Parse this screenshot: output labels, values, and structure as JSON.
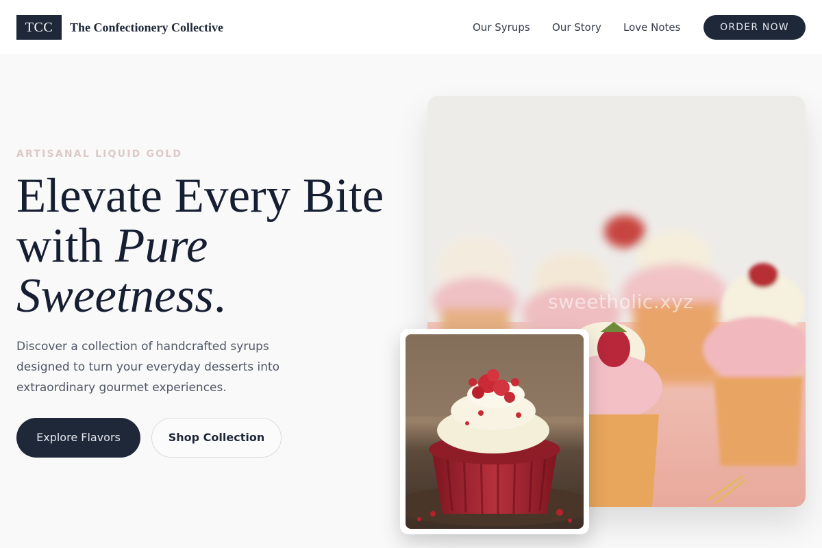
{
  "header": {
    "logo_text": "TCC",
    "brand_name": "The Confectionery Collective",
    "nav": [
      "Our Syrups",
      "Our Story",
      "Love Notes"
    ],
    "cta_label": "ORDER NOW"
  },
  "hero": {
    "eyebrow": "ARTISANAL LIQUID GOLD",
    "headline_line1": "Elevate Every Bite",
    "headline_line2_plain": "with ",
    "headline_line2_italic": "Pure",
    "headline_line3_italic": "Sweetness",
    "headline_line3_period": ".",
    "description": "Discover a collection of handcrafted syrups designed to turn your everyday desserts into extraordinary gourmet experiences.",
    "primary_button": "Explore Flavors",
    "secondary_button": "Shop Collection"
  },
  "media": {
    "main_image_watermark": "sweetholic.xyz",
    "main_image": "strawberry-topped-cupcakes-photo",
    "inset_image": "red-velvet-cupcake-photo"
  },
  "colors": {
    "navy": "#1f2839",
    "eyebrow": "#dcc9c7",
    "background": "#f9f9f9"
  }
}
